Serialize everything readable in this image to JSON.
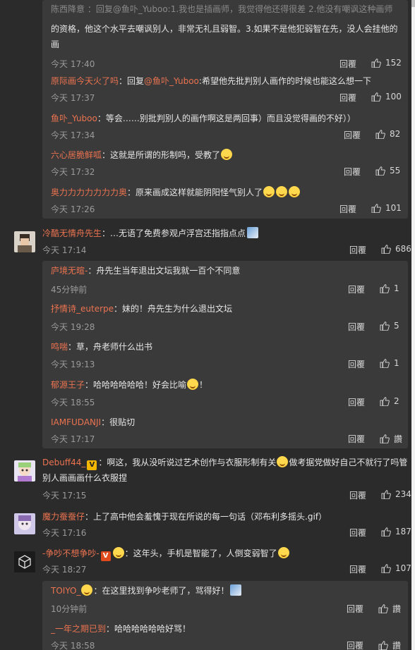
{
  "first_block": {
    "top_text_partial": "陈西降意 ：回复@鱼卟_Yuboo:1.我也是插画师，我觉得他还得很差 2.他没有嘲讽这种画师",
    "line2": "的资格，他这个水平去嘲讽别人，非常无礼且弱智。3.如果不是他犯弱智在先，没人会挂他的",
    "line3": "画",
    "time": "今天 17:40",
    "reply_label": "回覆",
    "likes": "152"
  },
  "replies_a": [
    {
      "user": "原际画今天火了吗",
      "sep": "：回复",
      "at": "@鱼卟_Yuboo",
      "text": ":希望他先批判别人画作的时候也能这么想一下",
      "time": "今天 17:37",
      "reply_label": "回覆",
      "likes": "100"
    },
    {
      "user": "鱼卟_Yuboo",
      "text": "：等会……别批判别人的画作啊这是两回事）而且没觉得画的不好））",
      "time": "今天 17:34",
      "reply_label": "回覆",
      "likes": "82"
    },
    {
      "user": "六心居脆鲜呱",
      "text": "：这就是所谓的形制吗，受教了",
      "time": "今天 17:32",
      "reply_label": "回覆",
      "likes": "55"
    },
    {
      "user": "奥力力力力力力力奥",
      "text": "：原来画成这样就能阴阳怪气别人了",
      "time": "今天 17:26",
      "reply_label": "回覆",
      "likes": "101"
    }
  ],
  "comment_zhou": {
    "user": "冷酷无情舟先生",
    "text": "：…无语了免费参观卢浮宫还指指点点",
    "time": "今天 17:14",
    "reply_label": "回覆",
    "likes": "686"
  },
  "replies_b": [
    {
      "user": "庐境无暄-",
      "text": "：舟先生当年退出文坛我就一百个不同意",
      "time": "45分钟前",
      "reply_label": "回覆",
      "likes": "1"
    },
    {
      "user": "抒情诗_euterpe",
      "text": "：妹的！舟先生为什么退出文坛",
      "time": "今天 19:28",
      "reply_label": "回覆",
      "likes": "5"
    },
    {
      "user": "鸣喘",
      "text": "：草，舟老师什么出书",
      "time": "今天 19:13",
      "reply_label": "回覆",
      "likes": "1"
    },
    {
      "user": "郁源王子",
      "text": "：哈哈哈哈哈哈！好会比喻",
      "text_tail": "！",
      "time": "今天 18:55",
      "reply_label": "回覆",
      "likes": "2"
    },
    {
      "user": "IAMFUDANJI",
      "text": "：很贴切",
      "time": "今天 17:17",
      "reply_label": "回覆",
      "likes": "讚"
    }
  ],
  "comment_debuff": {
    "user": "Debuff44_",
    "text": "：啊这，我从没听说过艺术创作与衣服形制有关",
    "text_tail": "做考据党做好自己不就行了吗管",
    "line2": "别人画画画什么衣服捏",
    "time": "今天 17:15",
    "reply_label": "回覆",
    "likes": "234"
  },
  "comment_moli": {
    "user": "魔力蚕蚕仔",
    "text": "：上了高中他会羞愧于现在所说的每一句话（邓布利多摇头.gif）",
    "time": "今天 17:16",
    "reply_label": "回覆",
    "likes": "187"
  },
  "comment_zhengchao": {
    "user": "-争吵不想争吵-",
    "text": "：这年头，手机是智能了，人倒变弱智了",
    "time": "今天 18:27",
    "reply_label": "回覆",
    "likes": "107"
  },
  "replies_c": [
    {
      "user": "TOIYO_",
      "text": "：在这里找到争吵老师了，骂得好！",
      "time": "10分钟前",
      "reply_label": "回覆",
      "likes": "讚"
    },
    {
      "user": "_一年之期已到",
      "text": "：哈哈哈哈哈哈好骂！",
      "time": "今天 18:58",
      "reply_label": "回覆",
      "likes": "讚"
    }
  ],
  "colors": {
    "username": "#eb7350",
    "bg": "#2b2b2b",
    "reply_bg": "#3a3a3a"
  }
}
